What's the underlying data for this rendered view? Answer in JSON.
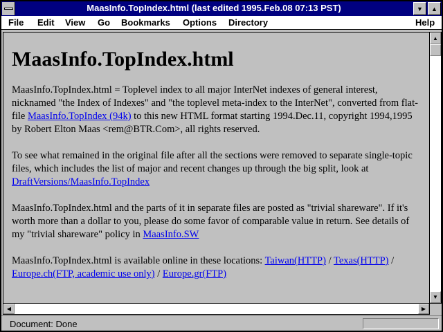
{
  "window": {
    "title": "MaasInfo.TopIndex.html (last edited 1995.Feb.08 07:13 PST)"
  },
  "menu": [
    {
      "label": "File"
    },
    {
      "label": "Edit"
    },
    {
      "label": "View"
    },
    {
      "label": "Go"
    },
    {
      "label": "Bookmarks"
    },
    {
      "label": "Options"
    },
    {
      "label": "Directory"
    },
    {
      "label": "Help"
    }
  ],
  "page": {
    "heading": "MaasInfo.TopIndex.html",
    "p1": {
      "text_before": "MaasInfo.TopIndex.html = Toplevel index to all major InterNet indexes of general interest, nicknamed \"the Index of Indexes\" and \"the toplevel meta-index to the InterNet\", converted from flat-file ",
      "link": "MaasInfo.TopIndex (94k)",
      "text_after": " to this new HTML format starting 1994.Dec.11, copyright 1994,1995 by Robert Elton Maas <rem@BTR.Com>, all rights reserved."
    },
    "p2": {
      "text_before": "To see what remained in the original file after all the sections were removed to separate single-topic files, which includes the list of major and recent changes up through the big split, look at ",
      "link": "DraftVersions/MaasInfo.TopIndex"
    },
    "p3": {
      "text_before": "MaasInfo.TopIndex.html and the parts of it in separate files are posted as \"trivial shareware\". If it's worth more than a dollar to you, please do some favor of comparable value in return. See details of my \"trivial shareware\" policy in ",
      "link": "MaasInfo.SW"
    },
    "p4": {
      "text_before": "MaasInfo.TopIndex.html is available online in these locations: ",
      "link1": "Taiwan(HTTP)",
      "sep1": " / ",
      "link2": "Texas(HTTP)",
      "sep2": " / ",
      "link3": "Europe.ch(FTP, academic use only)",
      "sep3": " / ",
      "link4": "Europe.gr(FTP)"
    }
  },
  "status": {
    "text": "Document: Done"
  },
  "icons": {
    "minimize": "minimize-icon",
    "maximize": "maximize-icon",
    "scroll_up": "arrow-up-icon",
    "scroll_down": "arrow-down-icon",
    "scroll_left": "arrow-left-icon",
    "scroll_right": "arrow-right-icon"
  },
  "colors": {
    "titlebar": "#000080",
    "link": "#0000ee",
    "background": "#c0c0c0"
  }
}
